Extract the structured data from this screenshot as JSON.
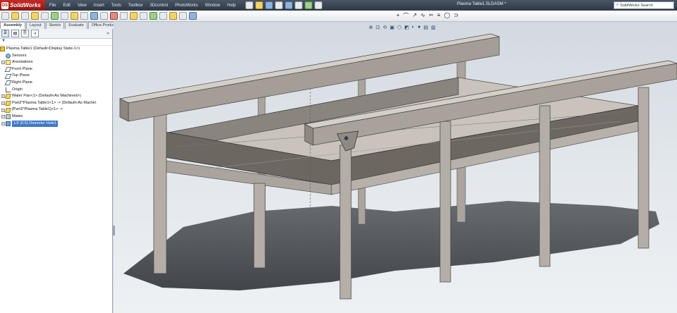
{
  "app": {
    "name": "SolidWorks",
    "document_title": "Plasma Table1.SLDASM *",
    "search_placeholder": "SolidWorks Search"
  },
  "menu": [
    "File",
    "Edit",
    "View",
    "Insert",
    "Tools",
    "Toolbox",
    "3Dcontrol",
    "PhotoWorks",
    "Window",
    "Help"
  ],
  "tabs": [
    {
      "label": "Assembly",
      "active": true
    },
    {
      "label": "Layout",
      "active": false
    },
    {
      "label": "Sketch",
      "active": false
    },
    {
      "label": "Evaluate",
      "active": false
    },
    {
      "label": "Office Products",
      "active": false
    }
  ],
  "feature_manager": {
    "filter_icon": "filter-icon",
    "more": "»",
    "tree": [
      {
        "label": "Plasma Table1  (Default<Display State-1>)",
        "icon": "assembly-icon",
        "level": 0,
        "expander": ""
      },
      {
        "label": "Sensors",
        "icon": "sensor-icon",
        "level": 1,
        "expander": ""
      },
      {
        "label": "Annotations",
        "icon": "annotation-icon",
        "level": 1,
        "expander": "+"
      },
      {
        "label": "Front Plane",
        "icon": "plane-icon",
        "level": 1,
        "expander": ""
      },
      {
        "label": "Top Plane",
        "icon": "plane-icon",
        "level": 1,
        "expander": ""
      },
      {
        "label": "Right Plane",
        "icon": "plane-icon",
        "level": 1,
        "expander": ""
      },
      {
        "label": "Origin",
        "icon": "origin-icon",
        "level": 1,
        "expander": ""
      },
      {
        "label": "Water Pan<1> (Default<As Machined>)",
        "icon": "part-icon",
        "level": 1,
        "expander": "+"
      },
      {
        "label": "Part2^Plasma Table1<1>  -> (Default<As Machin",
        "icon": "part-icon",
        "level": 1,
        "expander": "+"
      },
      {
        "label": "[Part3^Plasma Table1]<1> ->",
        "icon": "part-icon",
        "level": 1,
        "expander": "+"
      },
      {
        "label": "Mates",
        "icon": "mates-icon",
        "level": 1,
        "expander": "+"
      },
      {
        "label": "1/2 (0.5) Diameter Hole1",
        "icon": "hole-icon",
        "level": 1,
        "expander": "+",
        "selected": true
      }
    ]
  },
  "colors": {
    "menubar": "#2e3846",
    "selection": "#3c78c8",
    "steel": "#b7b1a9",
    "shadow": "#3f4348"
  }
}
